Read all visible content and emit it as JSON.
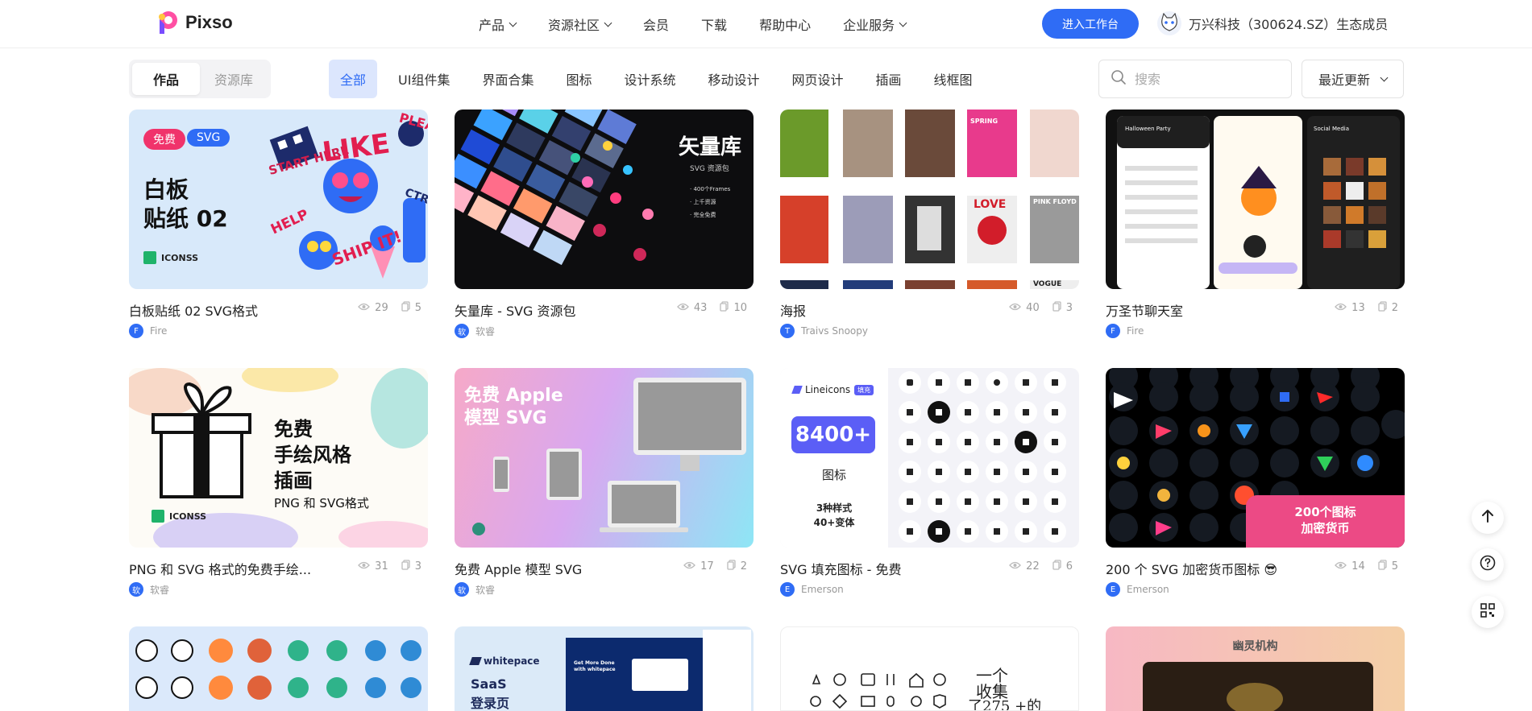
{
  "header": {
    "logo_text": "Pixso",
    "nav": [
      {
        "label": "产品",
        "dropdown": true
      },
      {
        "label": "资源社区",
        "dropdown": true
      },
      {
        "label": "会员",
        "dropdown": false
      },
      {
        "label": "下载",
        "dropdown": false
      },
      {
        "label": "帮助中心",
        "dropdown": false
      },
      {
        "label": "企业服务",
        "dropdown": true
      }
    ],
    "enter_button": "进入工作台",
    "partner_text": "万兴科技（300624.SZ）生态成员"
  },
  "filter": {
    "segments": [
      "作品",
      "资源库"
    ],
    "active_segment": "作品",
    "categories": [
      "全部",
      "UI组件集",
      "界面合集",
      "图标",
      "设计系统",
      "移动设计",
      "网页设计",
      "插画",
      "线框图"
    ],
    "active_category": "全部",
    "search_placeholder": "搜索",
    "sort_label": "最近更新"
  },
  "cards": [
    {
      "title": "白板贴纸 02 SVG格式",
      "views": "29",
      "copies": "5",
      "author": "Fire",
      "author_initial": "F",
      "thumb": {
        "tag1": "免费",
        "tag2": "SVG",
        "line1": "白板",
        "line2": "贴纸 02",
        "brand": "ICONSS",
        "s1": "LIKE",
        "s2": "START HERE",
        "s3": "HELP",
        "s4": "SHIP IT!",
        "s5": "PLEA",
        "s6": "CTR"
      }
    },
    {
      "title": "矢量库 - SVG 资源包",
      "views": "43",
      "copies": "10",
      "author": "软睿",
      "author_initial": "软",
      "thumb": {
        "heading": "矢量库",
        "sub": "SVG 资源包",
        "b1": "· 400个Frames",
        "b2": "· 上千资源",
        "b3": "· 完全免费"
      }
    },
    {
      "title": "海报",
      "views": "40",
      "copies": "3",
      "author": "Traivs Snoopy",
      "author_initial": "T",
      "thumb": {
        "p1": "LOVE",
        "p2": "PINK FLOYD",
        "p3": "SPRING",
        "p4": "VOGUE"
      }
    },
    {
      "title": "万圣节聊天室",
      "views": "13",
      "copies": "2",
      "author": "Fire",
      "author_initial": "F",
      "thumb": {
        "t1": "Halloween Party",
        "t2": "Social Media"
      }
    },
    {
      "title": "PNG 和 SVG 格式的免费手绘...",
      "views": "31",
      "copies": "3",
      "author": "软睿",
      "author_initial": "软",
      "thumb": {
        "line1": "免费",
        "line2": "手绘风格",
        "line3": "插画",
        "line4": "PNG 和 SVG格式",
        "brand": "ICONSS"
      }
    },
    {
      "title": "免费 Apple 模型 SVG",
      "views": "17",
      "copies": "2",
      "author": "软睿",
      "author_initial": "软",
      "thumb": {
        "line1": "免费 Apple",
        "line2": "模型 SVG"
      }
    },
    {
      "title": "SVG 填充图标 - 免费",
      "views": "22",
      "copies": "6",
      "author": "Emerson",
      "author_initial": "E",
      "thumb": {
        "brand": "Lineicons",
        "badge": "填充",
        "count": "8400+",
        "label": "图标",
        "line1": "3种样式",
        "line2": "40+变体"
      }
    },
    {
      "title": "200 个 SVG 加密货币图标 😎",
      "views": "14",
      "copies": "5",
      "author": "Emerson",
      "author_initial": "E",
      "thumb": {
        "line1": "200个图标",
        "line2": "加密货币"
      }
    },
    {
      "title": "",
      "views": "",
      "copies": "",
      "author": "",
      "author_initial": "",
      "thumb": {}
    },
    {
      "title": "",
      "views": "",
      "copies": "",
      "author": "",
      "author_initial": "",
      "thumb": {
        "brand": "whitepace",
        "line1": "SaaS",
        "line2": "登录页",
        "hero": "Get More Done with whitepace"
      }
    },
    {
      "title": "",
      "views": "",
      "copies": "",
      "author": "",
      "author_initial": "",
      "thumb": {
        "line1": "一个",
        "line2": "收集",
        "line3": "了275 +的"
      }
    },
    {
      "title": "",
      "views": "",
      "copies": "",
      "author": "",
      "author_initial": "",
      "thumb": {
        "heading": "幽灵机构"
      }
    }
  ],
  "colors": {
    "accent": "#2f6cf5",
    "accent_light": "#dce6fd"
  }
}
